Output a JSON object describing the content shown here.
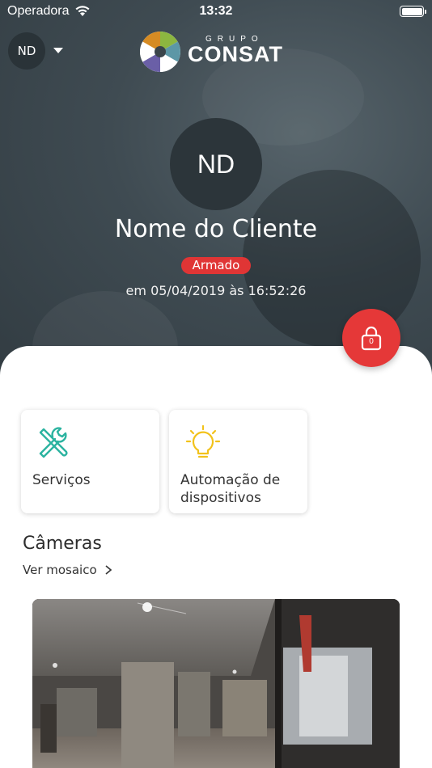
{
  "status_bar": {
    "carrier": "Operadora",
    "time": "13:32"
  },
  "account": {
    "initials": "ND"
  },
  "logo": {
    "grupo": "GRUPO",
    "name": "CONSAT"
  },
  "profile": {
    "initials": "ND",
    "name": "Nome do Cliente",
    "status": "Armado",
    "timestamp": "em 05/04/2019 às 16:52:26"
  },
  "lock": {
    "count": "0"
  },
  "cards": [
    {
      "label": "Serviços",
      "icon": "tools-icon"
    },
    {
      "label": "Automação de dispositivos",
      "icon": "lightbulb-icon"
    }
  ],
  "cameras": {
    "title": "Câmeras",
    "mosaic_link": "Ver mosaico"
  },
  "colors": {
    "accent_red": "#e53838",
    "services_icon": "#2bb3a0",
    "automation_icon": "#f2c21b",
    "hero_bg": "#3f4b52"
  }
}
